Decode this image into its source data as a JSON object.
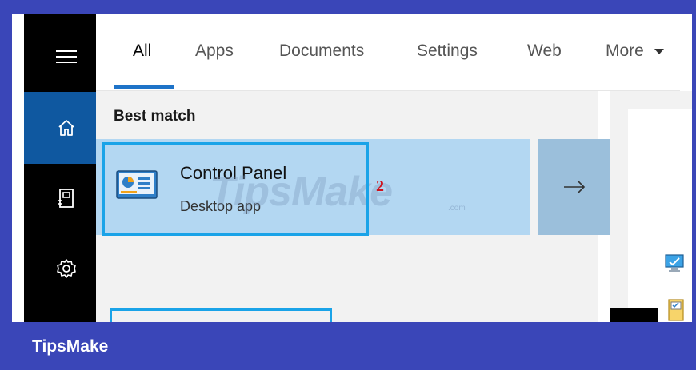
{
  "tabs": [
    {
      "label": "All",
      "active": true
    },
    {
      "label": "Apps"
    },
    {
      "label": "Documents"
    },
    {
      "label": "Settings"
    },
    {
      "label": "Web"
    },
    {
      "label": "More"
    }
  ],
  "rail": {
    "items": [
      {
        "icon": "hamburger-menu-icon"
      },
      {
        "icon": "home-icon",
        "active": true
      },
      {
        "icon": "notebook-icon"
      },
      {
        "icon": "gear-icon"
      }
    ]
  },
  "results": {
    "section_title": "Best match",
    "best": {
      "name": "Control Panel",
      "type": "Desktop app",
      "icon": "control-panel-icon"
    }
  },
  "annotation": {
    "step": "2"
  },
  "watermark": {
    "text": "TipsMake",
    "sub": ".com"
  },
  "brand": {
    "name": "TipsMake"
  },
  "colors": {
    "accent": "#1e73c8",
    "selection": "#b3d7f2",
    "rail": "#000000",
    "rail_active": "#0f58a0",
    "frame": "#3a46b8",
    "highlight": "#1aa3e8"
  }
}
